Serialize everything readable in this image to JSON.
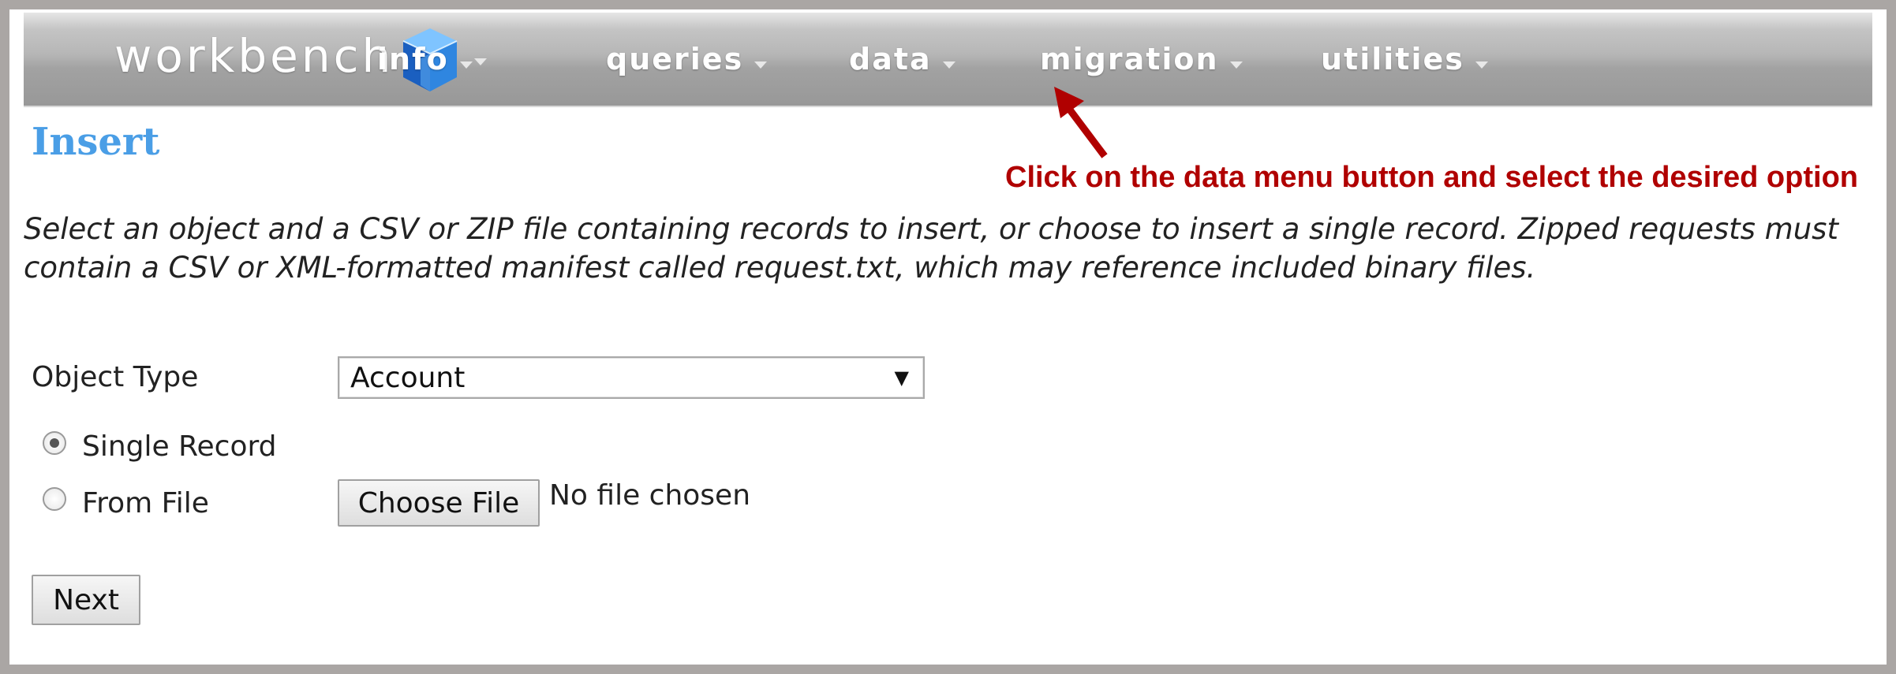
{
  "navbar": {
    "brand": "workbench",
    "items": [
      {
        "label": "info"
      },
      {
        "label": "queries"
      },
      {
        "label": "data"
      },
      {
        "label": "migration"
      },
      {
        "label": "utilities"
      }
    ]
  },
  "page": {
    "title": "Insert",
    "annotation": "Click on the data menu button and select the desired option",
    "description": "Select an object and a CSV or ZIP file containing records to insert, or choose to insert a single record. Zipped requests must contain a CSV or XML-formatted manifest called request.txt, which may reference included binary files."
  },
  "form": {
    "object_type_label": "Object Type",
    "object_type_value": "Account",
    "single_record_label": "Single Record",
    "single_record_checked": true,
    "from_file_label": "From File",
    "from_file_checked": false,
    "choose_file_label": "Choose File",
    "no_file_text": "No file chosen",
    "next_label": "Next"
  },
  "colors": {
    "title": "#4a9ee6",
    "annotation": "#b00000",
    "navbar": "#a2a2a2"
  }
}
